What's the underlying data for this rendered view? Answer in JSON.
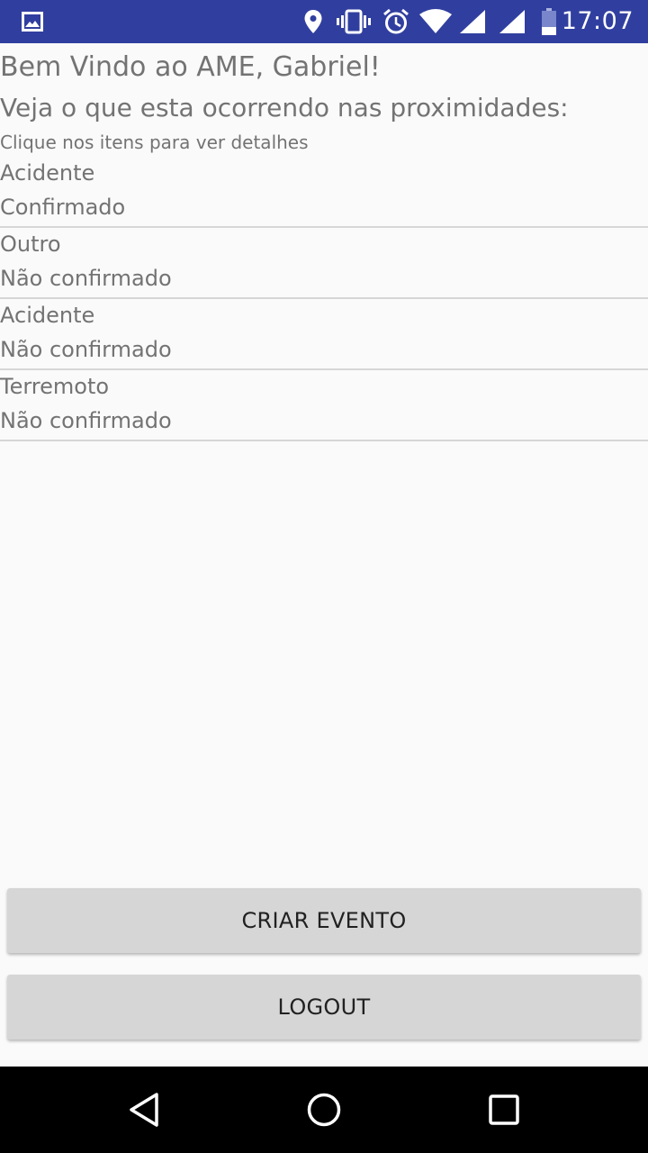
{
  "status_bar": {
    "time": "17:07",
    "icons": [
      "image-notification-icon",
      "location-icon",
      "vibrate-icon",
      "alarm-icon",
      "wifi-icon",
      "signal-icon",
      "signal-icon",
      "battery-icon"
    ]
  },
  "main": {
    "welcome": "Bem Vindo ao AME, Gabriel!",
    "subtitle": "Veja o que esta ocorrendo nas proximidades:",
    "hint": "Clique nos itens para ver detalhes",
    "events": [
      {
        "type": "Acidente",
        "status": "Confirmado"
      },
      {
        "type": "Outro",
        "status": "Não confirmado"
      },
      {
        "type": "Acidente",
        "status": "Não confirmado"
      },
      {
        "type": "Terremoto",
        "status": "Não confirmado"
      }
    ]
  },
  "buttons": {
    "create_event": "CRIAR EVENTO",
    "logout": "LOGOUT"
  },
  "nav_bar": {
    "icons": [
      "back-icon",
      "home-icon",
      "recents-icon"
    ]
  },
  "colors": {
    "status_bar": "#303f9f",
    "background": "#fafafa",
    "text": "#737373",
    "button": "#d6d6d6",
    "button_text": "#212121",
    "divider": "#d6d6d6",
    "nav_bar": "#000000"
  }
}
